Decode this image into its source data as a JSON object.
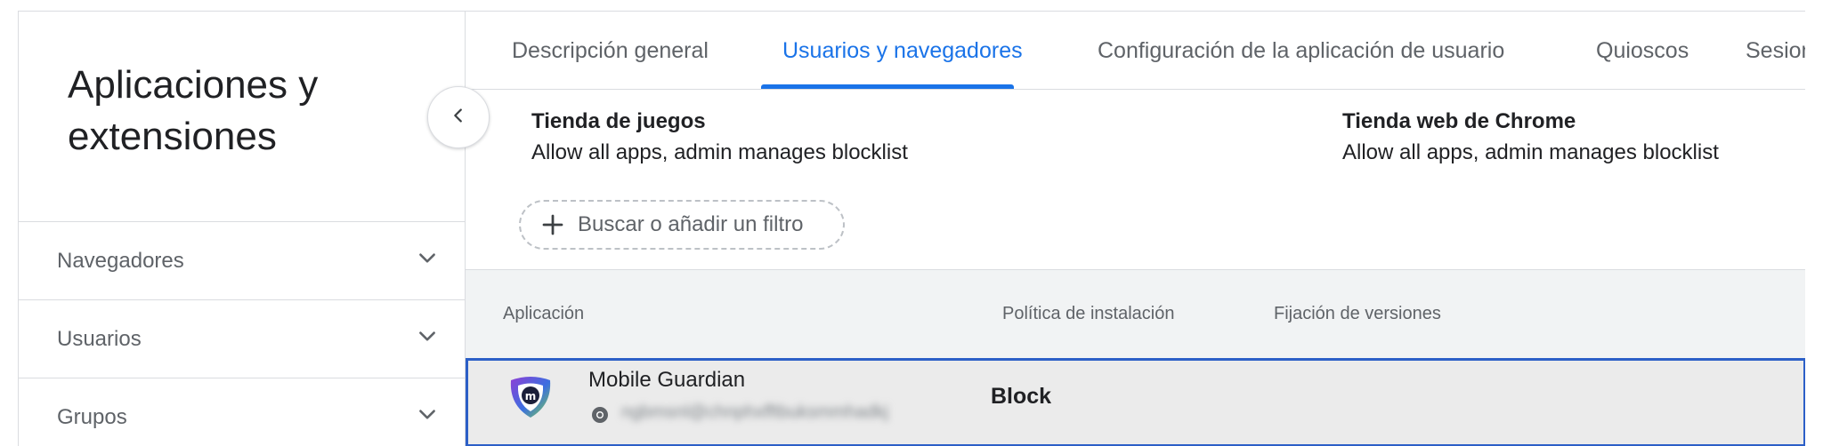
{
  "sidebar": {
    "title": "Aplicaciones y extensiones",
    "items": [
      {
        "label": "Navegadores"
      },
      {
        "label": "Usuarios"
      },
      {
        "label": "Grupos"
      }
    ]
  },
  "tabs": [
    {
      "label": "Descripción general"
    },
    {
      "label": "Usuarios y navegadores"
    },
    {
      "label": "Configuración de la aplicación de usuario"
    },
    {
      "label": "Quioscos"
    },
    {
      "label": "Sesiones"
    }
  ],
  "stores": {
    "play": {
      "title": "Tienda de juegos",
      "value": "Allow all apps, admin manages blocklist"
    },
    "chrome": {
      "title": "Tienda web de Chrome",
      "value": "Allow all apps, admin manages blocklist"
    }
  },
  "filter": {
    "label": "Buscar o añadir un filtro"
  },
  "table": {
    "headers": {
      "app": "Aplicación",
      "policy": "Política de instalación",
      "pinning": "Fijación de versiones"
    },
    "rows": [
      {
        "name": "Mobile Guardian",
        "email": "ngbmsnl@chnphxfftbuksmmhadkj",
        "policy": "Block"
      }
    ]
  },
  "colors": {
    "accent": "#1a73e8",
    "selected_border": "#2c5fc7"
  }
}
